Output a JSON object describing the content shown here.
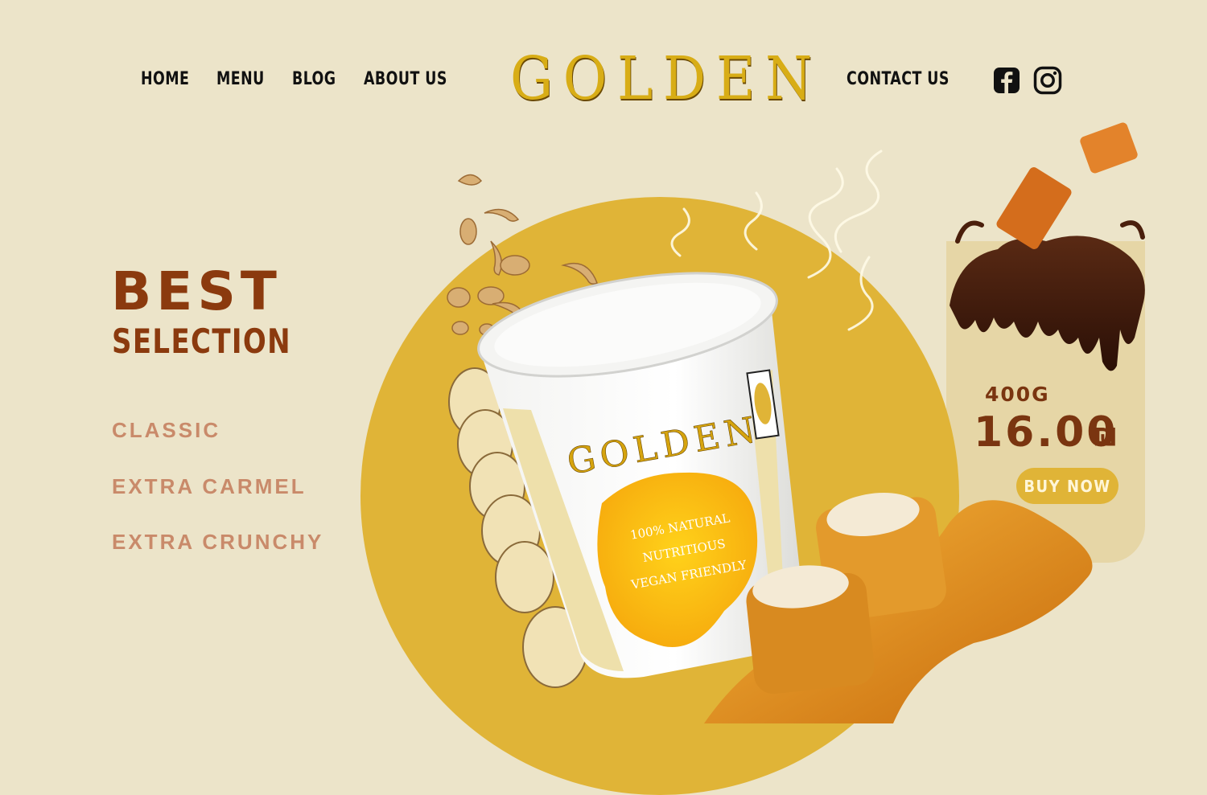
{
  "brand": {
    "logo_text": "GOLDEN"
  },
  "nav": {
    "home": "HOME",
    "menu": "MENU",
    "blog": "BLOG",
    "about": "ABOUT US",
    "contact": "CONTACT US"
  },
  "social": {
    "facebook_icon": "facebook-icon",
    "instagram_icon": "instagram-icon"
  },
  "hero": {
    "title_line1": "BEST",
    "title_line2": "SELECTION",
    "flavors": [
      "CLASSIC",
      "EXTRA CARMEL",
      "EXTRA CRUNCHY"
    ]
  },
  "product": {
    "tub_brand": "GOLDEN",
    "tub_claims": [
      "100% NATURAL",
      "NUTRITIOUS",
      "VEGAN FRIENDLY"
    ],
    "weight": "400G",
    "price": "16.00",
    "currency": "₪",
    "buy_label": "BUY NOW"
  },
  "colors": {
    "background": "#ece4c9",
    "accent_gold": "#e0b437",
    "brown": "#8b3a0e",
    "flavor_text": "#c98a6a",
    "card": "#e6d6a6"
  }
}
